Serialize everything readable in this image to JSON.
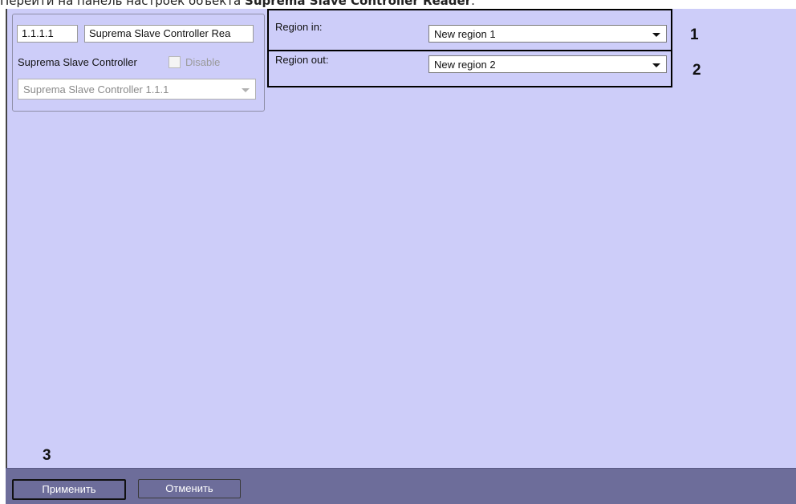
{
  "doc": {
    "intro_prefix": "Перейти на панель настроек объекта ",
    "intro_bold": "Suprema Slave Controller Reader",
    "intro_suffix": "."
  },
  "object": {
    "id": "1.1.1.1",
    "name": "Suprema Slave Controller Rea",
    "parent_label": "Suprema Slave Controller",
    "disable_label": "Disable",
    "parent_select": "Suprema Slave Controller 1.1.1"
  },
  "settings": {
    "region_in_label": "Region in:",
    "region_in_value": "New region 1",
    "region_out_label": "Region out:",
    "region_out_value": "New region 2"
  },
  "callouts": [
    "1",
    "2",
    "3"
  ],
  "buttons": {
    "apply": "Применить",
    "cancel": "Отменить"
  },
  "colors": {
    "panel_bg": "#cdcdf9",
    "bottom_bar": "#6d6d9a"
  }
}
